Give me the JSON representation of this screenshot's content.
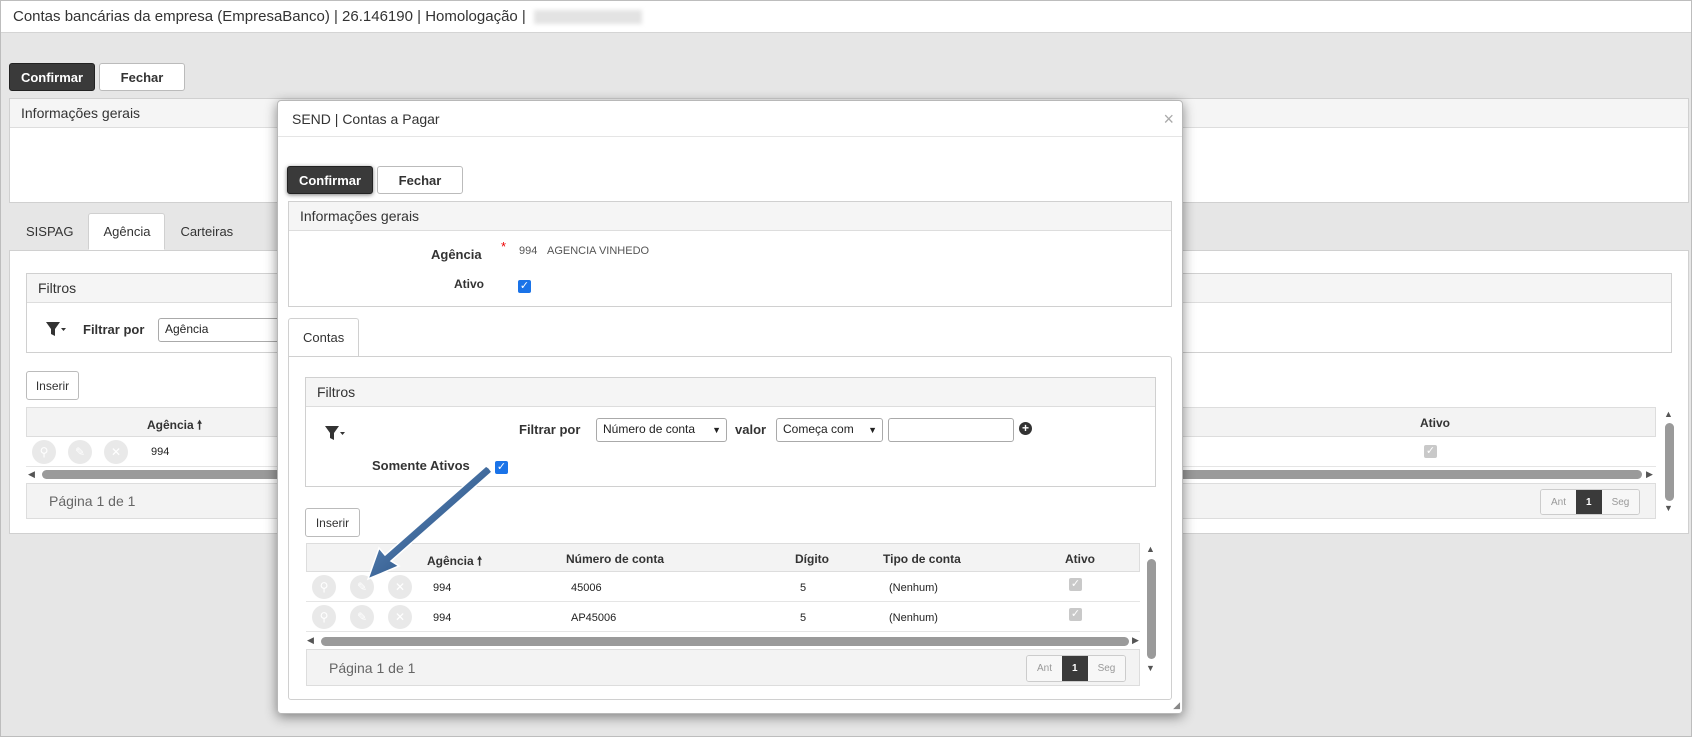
{
  "window": {
    "title": "Contas bancárias da empresa (EmpresaBanco) | 26.146190 | Homologação |"
  },
  "main": {
    "confirm_label": "Confirmar",
    "close_label": "Fechar",
    "general_info": "Informações gerais",
    "tabs": [
      {
        "label": "SISPAG"
      },
      {
        "label": "Agência"
      },
      {
        "label": "Carteiras"
      }
    ],
    "filters_title": "Filtros",
    "filter_by_label": "Filtrar por",
    "filter_by_value": "Agência",
    "insert_label": "Inserir",
    "col_agencia": "Agência",
    "col_ativo": "Ativo",
    "row_agencia": "994",
    "page_info": "Página 1 de 1",
    "pager": {
      "prev": "Ant",
      "current": "1",
      "next": "Seg"
    }
  },
  "modal": {
    "title": "SEND | Contas a Pagar",
    "close_x": "×",
    "confirm_label": "Confirmar",
    "close_label": "Fechar",
    "general_info": "Informações gerais",
    "agencia_label": "Agência",
    "required_mark": "*",
    "agencia_code": "994",
    "agencia_name": "AGENCIA VINHEDO",
    "ativo_label": "Ativo",
    "tab_contas": "Contas",
    "filters_title": "Filtros",
    "filter_by_label": "Filtrar por",
    "filter_by_value": "Número de conta",
    "valor_label": "valor",
    "valor_mode": "Começa com",
    "valor_input": "",
    "somente_ativos_label": "Somente Ativos",
    "insert_label": "Inserir",
    "columns": [
      "Agência",
      "Número de conta",
      "Dígito",
      "Tipo de conta",
      "Ativo"
    ],
    "rows": [
      {
        "agencia": "994",
        "numero": "45006",
        "digito": "5",
        "tipo": "(Nenhum)"
      },
      {
        "agencia": "994",
        "numero": "AP45006",
        "digito": "5",
        "tipo": "(Nenhum)"
      }
    ],
    "page_info": "Página 1 de 1",
    "pager": {
      "prev": "Ant",
      "current": "1",
      "next": "Seg"
    }
  },
  "colors": {
    "dark_button": "#3a3a3a",
    "checkbox_blue": "#1a73e8",
    "arrow_blue": "#1f4e89"
  },
  "icons": [
    "filter-icon",
    "search-icon",
    "edit-icon",
    "delete-icon",
    "plus-circle-icon",
    "sort-up-arrow-icon",
    "annotation-arrow"
  ]
}
